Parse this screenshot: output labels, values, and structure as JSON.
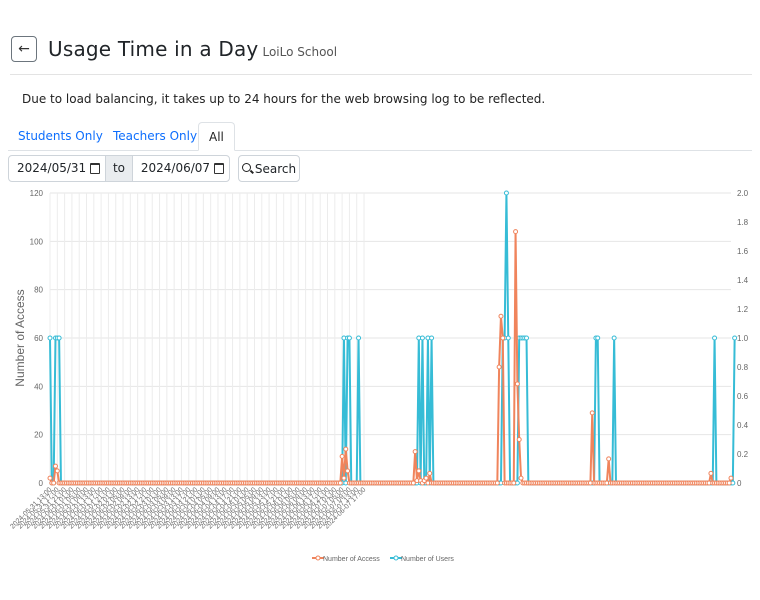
{
  "header": {
    "back_icon": "arrow-left-icon",
    "title": "Usage Time in a Day",
    "subtitle": "LoiLo School"
  },
  "notice": "Due to load balancing, it takes up to 24 hours for the web browsing log to be reflected.",
  "tabs": [
    {
      "label": "Students Only",
      "active": false
    },
    {
      "label": "Teachers Only",
      "active": false
    },
    {
      "label": "All",
      "active": true
    }
  ],
  "filters": {
    "date_from": "2024/05/31",
    "to_label": "to",
    "date_to": "2024/06/07",
    "search_label": "Search",
    "search_icon": "search-icon"
  },
  "colors": {
    "access": "#f0845c",
    "users": "#36bcd6"
  },
  "chart_data": {
    "type": "line",
    "ylabel": "Number of Access",
    "y_left": {
      "min": 0,
      "max": 120,
      "ticks": [
        0,
        20,
        40,
        60,
        80,
        100,
        120
      ]
    },
    "y_right": {
      "min": 0,
      "max": 2.0,
      "ticks": [
        0,
        0.2,
        0.4,
        0.6,
        0.8,
        1.0,
        1.2,
        1.4,
        1.6,
        1.8,
        2.0
      ]
    },
    "x_start": "2024-05-31 13:00",
    "x_tick_labels": [
      "2024-05-31 13:00",
      "2024-05-31 17:00",
      "2024-05-31 21:00",
      "2024-06-01 01:00",
      "2024-06-01 05:00",
      "2024-06-01 09:00",
      "2024-06-01 13:00",
      "2024-06-01 17:00",
      "2024-06-01 21:00",
      "2024-06-02 01:00",
      "2024-06-02 05:00",
      "2024-06-02 09:00",
      "2024-06-02 13:00",
      "2024-06-02 17:00",
      "2024-06-02 21:00",
      "2024-06-03 01:00",
      "2024-06-03 05:00",
      "2024-06-03 09:00",
      "2024-06-03 13:00",
      "2024-06-03 17:00",
      "2024-06-03 21:00",
      "2024-06-04 01:00",
      "2024-06-04 05:00",
      "2024-06-04 09:00",
      "2024-06-04 13:00",
      "2024-06-04 17:00",
      "2024-06-04 21:00",
      "2024-06-05 01:00",
      "2024-06-05 05:00",
      "2024-06-05 09:00",
      "2024-06-05 13:00",
      "2024-06-05 17:00",
      "2024-06-05 21:00",
      "2024-06-06 01:00",
      "2024-06-06 05:00",
      "2024-06-06 09:00",
      "2024-06-06 13:00",
      "2024-06-06 17:00",
      "2024-06-06 21:00",
      "2024-06-07 01:00",
      "2024-06-07 05:00",
      "2024-06-07 09:00",
      "2024-06-07 13:00",
      "2024-06-07 17:00"
    ],
    "series": [
      {
        "name": "Number of Access",
        "axis": "left",
        "values": [
          2,
          0,
          0,
          7,
          5,
          0,
          0,
          0,
          0,
          0,
          0,
          0,
          0,
          0,
          0,
          0,
          0,
          0,
          0,
          0,
          0,
          0,
          0,
          0,
          0,
          0,
          0,
          0,
          0,
          0,
          0,
          0,
          0,
          0,
          0,
          0,
          0,
          0,
          0,
          0,
          0,
          0,
          0,
          0,
          0,
          0,
          0,
          0,
          0,
          0,
          0,
          0,
          0,
          0,
          0,
          0,
          0,
          0,
          0,
          0,
          0,
          0,
          0,
          0,
          0,
          0,
          0,
          0,
          0,
          0,
          0,
          0,
          0,
          0,
          0,
          0,
          0,
          0,
          0,
          0,
          0,
          0,
          0,
          0,
          0,
          0,
          0,
          0,
          0,
          0,
          0,
          0,
          0,
          0,
          0,
          0,
          0,
          0,
          0,
          0,
          0,
          0,
          0,
          0,
          0,
          0,
          0,
          0,
          0,
          0,
          0,
          0,
          0,
          0,
          0,
          0,
          0,
          0,
          0,
          0,
          0,
          0,
          0,
          0,
          0,
          0,
          0,
          0,
          0,
          0,
          0,
          0,
          0,
          0,
          0,
          0,
          0,
          0,
          0,
          0,
          0,
          0,
          0,
          0,
          0,
          0,
          0,
          0,
          0,
          0,
          0,
          0,
          0,
          0,
          0,
          0,
          0,
          0,
          0,
          0,
          11,
          2,
          14,
          5,
          0,
          0,
          0,
          0,
          0,
          0,
          0,
          0,
          0,
          0,
          0,
          0,
          0,
          0,
          0,
          0,
          0,
          0,
          0,
          0,
          0,
          0,
          0,
          0,
          0,
          0,
          0,
          0,
          0,
          0,
          0,
          0,
          0,
          0,
          0,
          0,
          13,
          1,
          5,
          1,
          0,
          1,
          2,
          0,
          4,
          0,
          0,
          0,
          0,
          0,
          0,
          0,
          0,
          0,
          0,
          0,
          0,
          0,
          0,
          0,
          0,
          0,
          0,
          0,
          0,
          0,
          0,
          0,
          0,
          0,
          0,
          0,
          0,
          0,
          0,
          0,
          0,
          0,
          0,
          0,
          0,
          0,
          48,
          69,
          60,
          0,
          0,
          0,
          0,
          0,
          0,
          104,
          41,
          18,
          2,
          0,
          0,
          0,
          0,
          0,
          0,
          0,
          0,
          0,
          0,
          0,
          0,
          0,
          0,
          0,
          0,
          0,
          0,
          0,
          0,
          0,
          0,
          0,
          0,
          0,
          0,
          0,
          0,
          0,
          0,
          0,
          0,
          0,
          0,
          0,
          0,
          0,
          0,
          29,
          0,
          0,
          0,
          0,
          0,
          0,
          0,
          0,
          10,
          0,
          0,
          0,
          0,
          0,
          0,
          0,
          0,
          0,
          0,
          0,
          0,
          0,
          0,
          0,
          0,
          0,
          0,
          0,
          0,
          0,
          0,
          0,
          0,
          0,
          0,
          0,
          0,
          0,
          0,
          0,
          0,
          0,
          0,
          0,
          0,
          0,
          0,
          0,
          0,
          0,
          0,
          0,
          0,
          0,
          0,
          0,
          0,
          0,
          0,
          0,
          0,
          0,
          0,
          0,
          4,
          0,
          0,
          0,
          0,
          0,
          0,
          0,
          0,
          0,
          0,
          2
        ]
      },
      {
        "name": "Number of Users",
        "axis": "right",
        "values": [
          1,
          0,
          0,
          1,
          1,
          1,
          0,
          0,
          0,
          0,
          0,
          0,
          0,
          0,
          0,
          0,
          0,
          0,
          0,
          0,
          0,
          0,
          0,
          0,
          0,
          0,
          0,
          0,
          0,
          0,
          0,
          0,
          0,
          0,
          0,
          0,
          0,
          0,
          0,
          0,
          0,
          0,
          0,
          0,
          0,
          0,
          0,
          0,
          0,
          0,
          0,
          0,
          0,
          0,
          0,
          0,
          0,
          0,
          0,
          0,
          0,
          0,
          0,
          0,
          0,
          0,
          0,
          0,
          0,
          0,
          0,
          0,
          0,
          0,
          0,
          0,
          0,
          0,
          0,
          0,
          0,
          0,
          0,
          0,
          0,
          0,
          0,
          0,
          0,
          0,
          0,
          0,
          0,
          0,
          0,
          0,
          0,
          0,
          0,
          0,
          0,
          0,
          0,
          0,
          0,
          0,
          0,
          0,
          0,
          0,
          0,
          0,
          0,
          0,
          0,
          0,
          0,
          0,
          0,
          0,
          0,
          0,
          0,
          0,
          0,
          0,
          0,
          0,
          0,
          0,
          0,
          0,
          0,
          0,
          0,
          0,
          0,
          0,
          0,
          0,
          0,
          0,
          0,
          0,
          0,
          0,
          0,
          0,
          0,
          0,
          0,
          0,
          0,
          0,
          0,
          0,
          0,
          0,
          0,
          0,
          0,
          1,
          0,
          1,
          1,
          0,
          0,
          0,
          0,
          1,
          0,
          0,
          0,
          0,
          0,
          0,
          0,
          0,
          0,
          0,
          0,
          0,
          0,
          0,
          0,
          0,
          0,
          0,
          0,
          0,
          0,
          0,
          0,
          0,
          0,
          0,
          0,
          0,
          0,
          0,
          0,
          0,
          1,
          0,
          1,
          0,
          0,
          1,
          0,
          1,
          0,
          0,
          0,
          0,
          0,
          0,
          0,
          0,
          0,
          0,
          0,
          0,
          0,
          0,
          0,
          0,
          0,
          0,
          0,
          0,
          0,
          0,
          0,
          0,
          0,
          0,
          0,
          0,
          0,
          0,
          0,
          0,
          0,
          0,
          0,
          0,
          0,
          0,
          1,
          1,
          2,
          1,
          0,
          0,
          0,
          0,
          0,
          1,
          1,
          1,
          1,
          1,
          0,
          0,
          0,
          0,
          0,
          0,
          0,
          0,
          0,
          0,
          0,
          0,
          0,
          0,
          0,
          0,
          0,
          0,
          0,
          0,
          0,
          0,
          0,
          0,
          0,
          0,
          0,
          0,
          0,
          0,
          0,
          0,
          0,
          0,
          0,
          0,
          0,
          1,
          1,
          0,
          0,
          0,
          0,
          0,
          0,
          0,
          0,
          1,
          0,
          0,
          0,
          0,
          0,
          0,
          0,
          0,
          0,
          0,
          0,
          0,
          0,
          0,
          0,
          0,
          0,
          0,
          0,
          0,
          0,
          0,
          0,
          0,
          0,
          0,
          0,
          0,
          0,
          0,
          0,
          0,
          0,
          0,
          0,
          0,
          0,
          0,
          0,
          0,
          0,
          0,
          0,
          0,
          0,
          0,
          0,
          0,
          0,
          0,
          0,
          0,
          0,
          0,
          1,
          0,
          0,
          0,
          0,
          0,
          0,
          0,
          0,
          0,
          0,
          1
        ]
      }
    ],
    "legend": "bottom",
    "grid": true
  }
}
